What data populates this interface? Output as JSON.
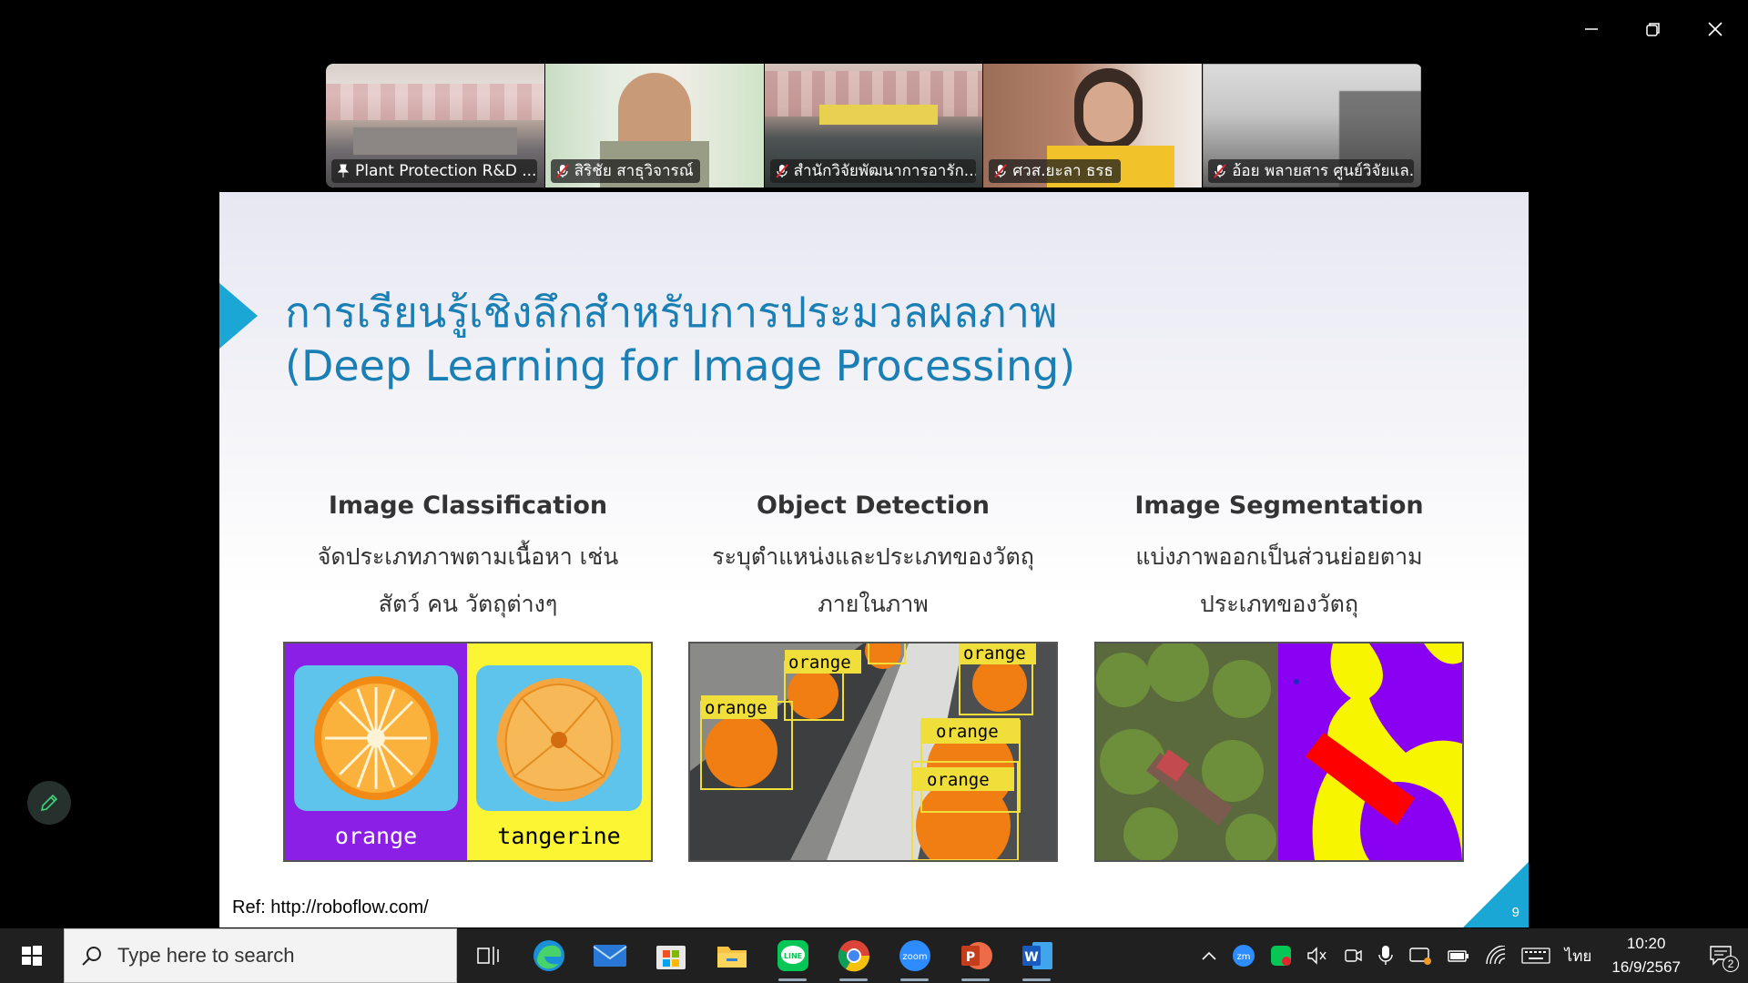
{
  "window_controls": {
    "minimize_icon": "minimize-icon",
    "restore_icon": "restore-icon",
    "close_icon": "close-icon"
  },
  "participants": [
    {
      "name": "Plant Protection R&D ...",
      "status_icon": "pin-icon",
      "active": true
    },
    {
      "name": "สิริชัย สาธุวิจารณ์",
      "status_icon": "mic-muted-icon",
      "active": false
    },
    {
      "name": "สำนักวิจัยพัฒนาการอารัก...",
      "status_icon": "mic-muted-icon",
      "active": false
    },
    {
      "name": "ศวส.ยะลา ธรธ",
      "status_icon": "mic-muted-icon",
      "active": false
    },
    {
      "name": "อ้อย พลายสาร ศูนย์วิจัยแล...",
      "status_icon": "mic-muted-icon",
      "active": false
    }
  ],
  "slide": {
    "title_th": "การเรียนรู้เชิงลึกสำหรับการประมวลผลภาพ",
    "title_en": "(Deep Learning for Image Processing)",
    "columns": [
      {
        "heading": "Image Classification",
        "desc_line1": "จัดประเภทภาพตามเนื้อหา เช่น",
        "desc_line2": "สัตว์ คน วัตถุต่างๆ"
      },
      {
        "heading": "Object Detection",
        "desc_line1": "ระบุตำแหน่งและประเภทของวัตถุ",
        "desc_line2": "ภายในภาพ"
      },
      {
        "heading": "Image Segmentation",
        "desc_line1": "แบ่งภาพออกเป็นส่วนย่อยตาม",
        "desc_line2": "ประเภทของวัตถุ"
      }
    ],
    "classification_labels": [
      "orange",
      "tangerine"
    ],
    "detection_labels": [
      "orange",
      "orange",
      "orange",
      "orange",
      "orange"
    ],
    "ref": "Ref: http://roboflow.com/",
    "page_number": "9"
  },
  "taskbar": {
    "search_placeholder": "Type here to search",
    "apps": [
      "task-view-icon",
      "edge-icon",
      "mail-icon",
      "store-icon",
      "file-explorer-icon",
      "line-icon",
      "chrome-icon",
      "zoom-icon",
      "powerpoint-icon",
      "word-icon"
    ],
    "language": "ไทย",
    "time": "10:20",
    "date": "16/9/2567",
    "notification_count": "2"
  }
}
